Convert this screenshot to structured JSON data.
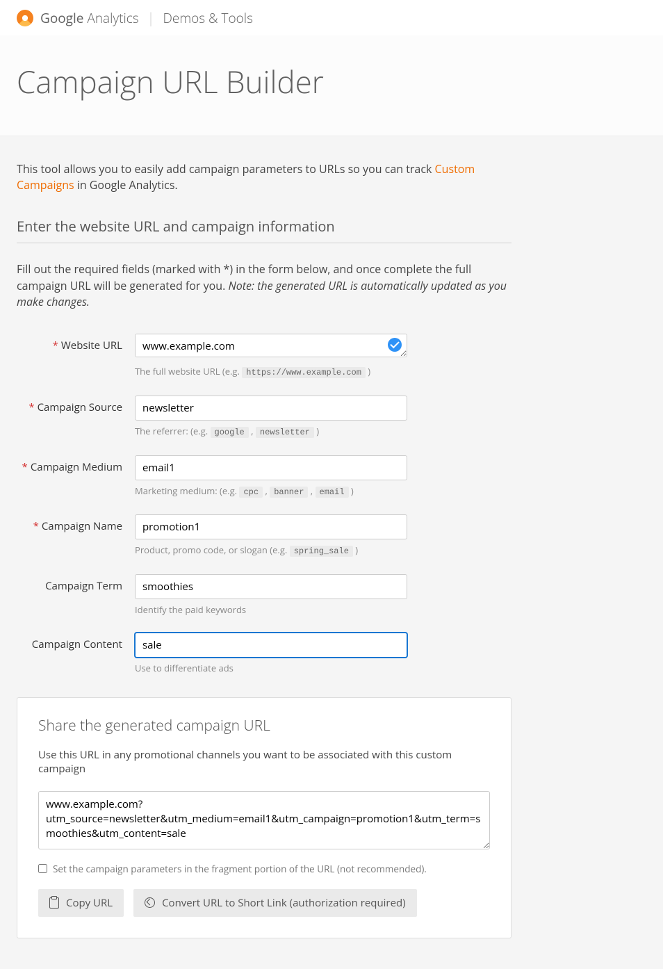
{
  "header": {
    "brand_bold": "Google",
    "brand_light": " Analytics",
    "sub": "Demos & Tools"
  },
  "page": {
    "title": "Campaign URL Builder",
    "intro_pre": "This tool allows you to easily add campaign parameters to URLs so you can track ",
    "intro_link": "Custom Campaigns",
    "intro_post": " in Google Analytics.",
    "section_heading": "Enter the website URL and campaign information",
    "instructions_pre": "Fill out the required fields (marked with *) in the form below, and once complete the full campaign URL will be generated for you. ",
    "instructions_note": "Note: the generated URL is automatically updated as you make changes."
  },
  "fields": {
    "website_url": {
      "label": "Website URL",
      "value": "www.example.com",
      "hint_pre": "The full website URL (e.g. ",
      "hint_code1": "https://www.example.com",
      "hint_post": " )"
    },
    "source": {
      "label": "Campaign Source",
      "value": "newsletter",
      "hint_pre": "The referrer: (e.g. ",
      "hint_code1": "google",
      "hint_sep1": " , ",
      "hint_code2": "newsletter",
      "hint_post": " )"
    },
    "medium": {
      "label": "Campaign Medium",
      "value": "email1",
      "hint_pre": "Marketing medium: (e.g. ",
      "hint_code1": "cpc",
      "hint_sep1": " , ",
      "hint_code2": "banner",
      "hint_sep2": " , ",
      "hint_code3": "email",
      "hint_post": " )"
    },
    "name": {
      "label": "Campaign Name",
      "value": "promotion1",
      "hint_pre": "Product, promo code, or slogan (e.g. ",
      "hint_code1": "spring_sale",
      "hint_post": " )"
    },
    "term": {
      "label": "Campaign Term",
      "value": "smoothies",
      "hint": "Identify the paid keywords"
    },
    "content": {
      "label": "Campaign Content",
      "value": "sale",
      "hint": "Use to differentiate ads"
    }
  },
  "share": {
    "title": "Share the generated campaign URL",
    "desc": "Use this URL in any promotional channels you want to be associated with this custom campaign",
    "generated": "www.example.com?utm_source=newsletter&utm_medium=email1&utm_campaign=promotion1&utm_term=smoothies&utm_content=sale",
    "checkbox_label": "Set the campaign parameters in the fragment portion of the URL (not recommended).",
    "copy_btn": "Copy URL",
    "convert_btn": "Convert URL to Short Link (authorization required)"
  }
}
